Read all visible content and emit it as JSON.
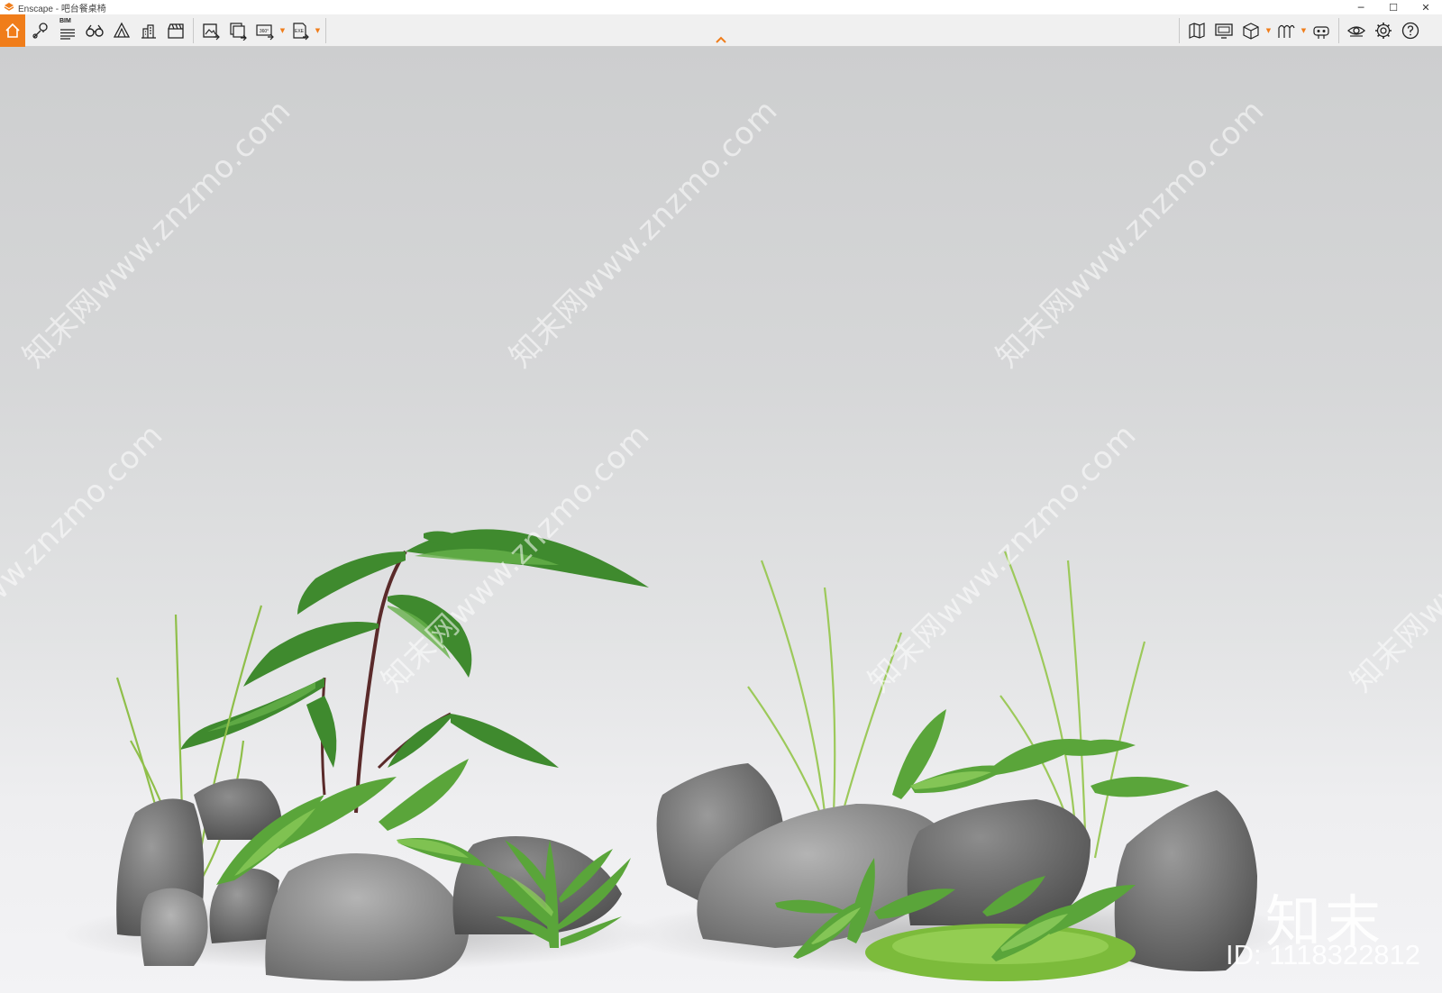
{
  "window": {
    "app_name": "Enscape",
    "separator": " - ",
    "document_name": "吧台餐桌椅",
    "minimize": "─",
    "maximize": "☐",
    "close": "✕"
  },
  "toolbar": {
    "bim_label": "BIM",
    "pano_label": "360°",
    "exe_label": "EXE",
    "accent_color": "#f07d1a"
  },
  "viewport": {
    "watermark_text": "知末网www.znzmo.com",
    "logo_text": "知末",
    "id_text": "ID: 1118322812"
  }
}
